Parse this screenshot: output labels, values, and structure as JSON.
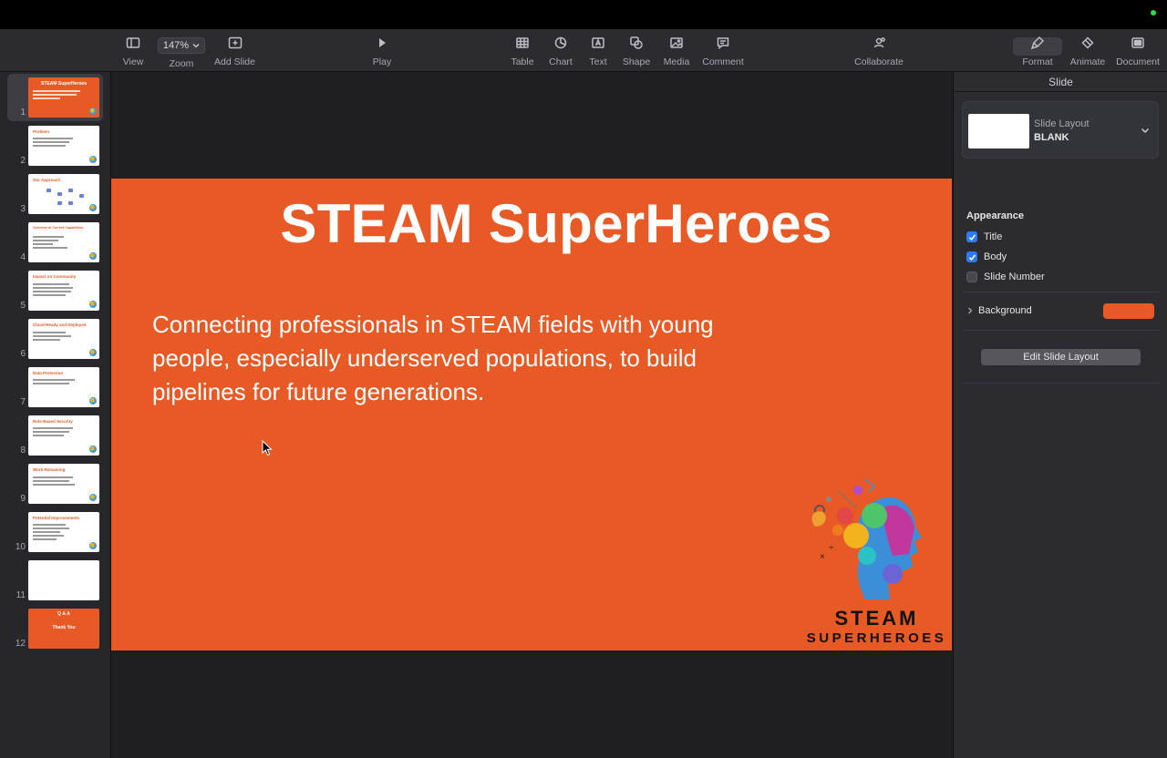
{
  "toolbar": {
    "view": "View",
    "zoom_value": "147%",
    "zoom": "Zoom",
    "add_slide": "Add Slide",
    "play": "Play",
    "table": "Table",
    "chart": "Chart",
    "text": "Text",
    "shape": "Shape",
    "media": "Media",
    "comment": "Comment",
    "collaborate": "Collaborate",
    "format": "Format",
    "animate": "Animate",
    "document": "Document"
  },
  "navigator": {
    "slides": [
      {
        "number": "1",
        "title": "STEAM SuperHeroes",
        "selected": true
      },
      {
        "number": "2",
        "title": "Problem"
      },
      {
        "number": "3",
        "title": "Our Approach"
      },
      {
        "number": "4",
        "title": "Overview of Current Capabilities"
      },
      {
        "number": "5",
        "title": "Impact on Community"
      },
      {
        "number": "6",
        "title": "Cloud-Ready and Deployed"
      },
      {
        "number": "7",
        "title": "Data Protection"
      },
      {
        "number": "8",
        "title": "Role-Based Security"
      },
      {
        "number": "9",
        "title": "Work Remaining"
      },
      {
        "number": "10",
        "title": "Potential Improvements"
      },
      {
        "number": "11",
        "title": ""
      },
      {
        "number": "12",
        "title": "Q & A",
        "subtitle": "Thank You"
      }
    ]
  },
  "slide": {
    "title": "STEAM SuperHeroes",
    "body": "Connecting professionals in STEAM fields with young people, especially underserved populations, to build pipelines for future generations.",
    "logo_line1": "STEAM",
    "logo_line2": "SUPERHEROES",
    "background_color": "#e75a25"
  },
  "inspector": {
    "header": "Slide",
    "layout_label": "Slide Layout",
    "layout_value": "BLANK",
    "appearance_title": "Appearance",
    "checkboxes": [
      {
        "label": "Title",
        "checked": true
      },
      {
        "label": "Body",
        "checked": true
      },
      {
        "label": "Slide Number",
        "checked": false
      }
    ],
    "background_label": "Background",
    "background_color": "#e75a25",
    "edit_layout_button": "Edit Slide Layout"
  }
}
